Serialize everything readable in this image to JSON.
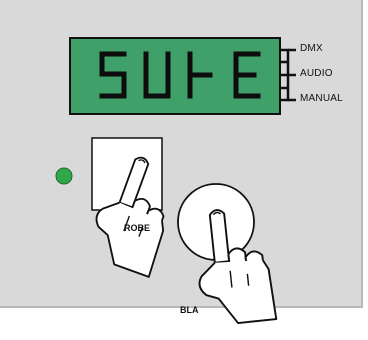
{
  "display": {
    "text": "SUHE",
    "bg_color": "#3fa169",
    "segment_color": "#0d0d0d"
  },
  "modes": [
    {
      "label": "DMX"
    },
    {
      "label": "AUDIO"
    },
    {
      "label": "MANUAL"
    }
  ],
  "led": {
    "color": "#2fa84a"
  },
  "strobe_button": {
    "label": "ROBE"
  },
  "blackout_button": {
    "label": "BLA"
  },
  "icons": [
    "pointing-hand-icon",
    "pointing-hand-icon"
  ]
}
